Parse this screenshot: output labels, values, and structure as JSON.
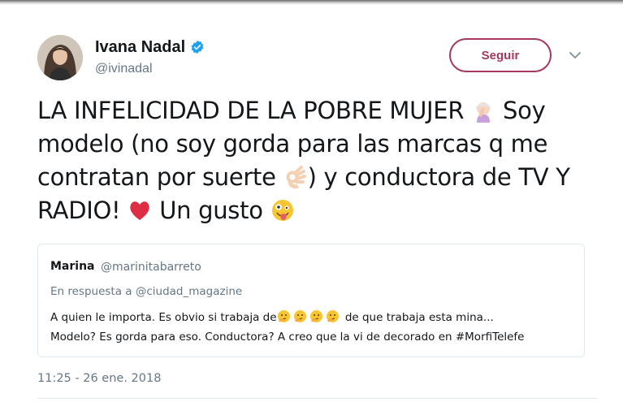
{
  "author": {
    "display_name": "Ivana Nadal",
    "handle": "@ivinadal",
    "verified": true
  },
  "follow_button": {
    "label": "Seguir"
  },
  "tweet": {
    "part1": "LA INFELICIDAD DE LA POBRE MUJER ",
    "emoji1": "woman-facepalming-icon",
    "part2": " Soy modelo (no soy gorda para las marcas q me contratan por suerte ",
    "emoji2": "ok-hand-icon",
    "part3": ") y conductora de TV Y RADIO! ",
    "emoji3": "red-heart-icon",
    "part4": " Un gusto ",
    "emoji4": "zany-face-icon",
    "timestamp": "11:25 - 26 ene. 2018"
  },
  "quoted_tweet": {
    "name": "Marina",
    "handle": "@marinitabarreto",
    "reply_to": "En respuesta a @ciudad_magazine",
    "text_part1": "A quien le importa. Es obvio si trabaja de",
    "emoji": "thinking-face-icon",
    "emoji_count": 4,
    "text_part2": " de que trabaja esta mina...",
    "text_line2": "Modelo? Es gorda para eso. Conductora? A creo que la vi de decorado en #MorfiTelefe"
  },
  "colors": {
    "follow_accent": "#a5395c",
    "verified_blue": "#1da1f2",
    "secondary_text": "#657786",
    "border": "#e1e8ed"
  }
}
